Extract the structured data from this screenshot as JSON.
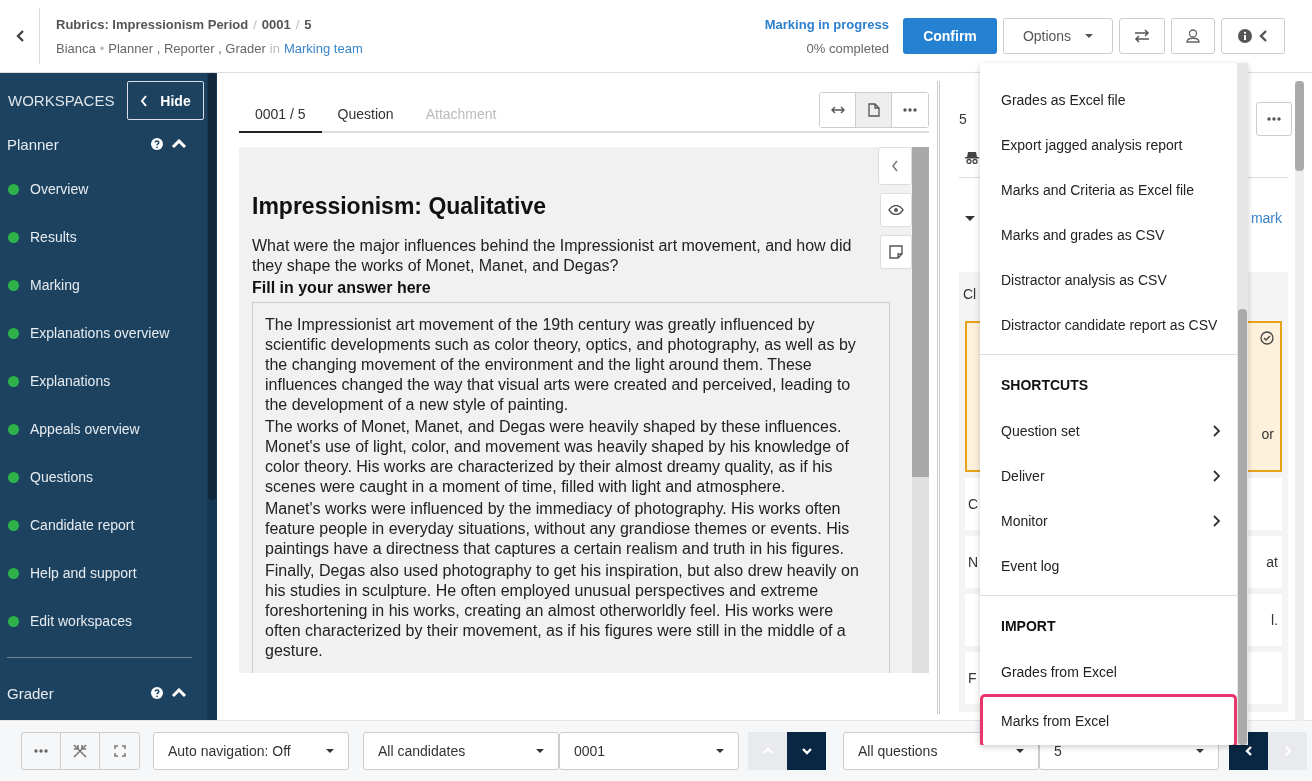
{
  "header": {
    "breadcrumb": [
      "Rubrics: Impressionism Period",
      "0001",
      "5"
    ],
    "separator": "/",
    "user": "Bianca",
    "bullet": "•",
    "roles": "Planner , Reporter , Grader",
    "in": "in",
    "team": "Marking team",
    "status": "Marking in progress",
    "progress": "0% completed",
    "confirm": "Confirm",
    "options": "Options"
  },
  "sidebar": {
    "title": "WORKSPACES",
    "hide": "Hide",
    "sections": [
      {
        "name": "Planner",
        "expanded": true,
        "items": [
          {
            "label": "Overview",
            "color": "#2db34a"
          },
          {
            "label": "Results",
            "color": "#2db34a"
          },
          {
            "label": "Marking",
            "color": "#2db34a"
          },
          {
            "label": "Explanations overview",
            "color": "#2db34a"
          },
          {
            "label": "Explanations",
            "color": "#2db34a"
          },
          {
            "label": "Appeals overview",
            "color": "#2db34a"
          },
          {
            "label": "Questions",
            "color": "#2db34a"
          },
          {
            "label": "Candidate report",
            "color": "#2db34a"
          },
          {
            "label": "Help and support",
            "color": "#2db34a"
          },
          {
            "label": "Edit workspaces",
            "color": "#2db34a"
          }
        ]
      },
      {
        "name": "Grader",
        "expanded": true
      }
    ]
  },
  "document": {
    "tabs": [
      {
        "label": "0001 / 5",
        "selected": true,
        "disabled": false
      },
      {
        "label": "Question",
        "selected": false,
        "disabled": false
      },
      {
        "label": "Attachment",
        "selected": false,
        "disabled": true
      }
    ],
    "title": "Impressionism: Qualitative",
    "question": "What were the major influences behind the Impressionist art movement, and how did they shape the works of Monet, Manet, and Degas?",
    "answer_label": "Fill in your answer here",
    "answer": [
      "The Impressionist art movement of the 19th century was greatly influenced by scientific developments such as color theory, optics, and photography, as well as by the changing movement of the environment and the light around them. These influences changed the way that visual arts were created and perceived, leading to the development of a new style of painting.",
      "The works of Monet, Manet, and Degas were heavily shaped by these influences. Monet's use of light, color, and movement was heavily shaped by his knowledge of color theory. His works are characterized by their almost dreamy quality, as if his scenes were caught in a moment of time, filled with light and atmosphere.",
      "Manet's works were influenced by the immediacy of photography. His works often feature people in everyday situations, without any grandiose themes or events. His paintings have a directness that captures a certain realism and truth in his figures.",
      "Finally, Degas also used photography to get his inspiration, but also drew heavily on his studies in sculpture. He often employed unusual perspectives and extreme foreshortening in his works, creating an almost otherworldly feel. His works were often characterized by their movement, as if his figures were still in the middle of a gesture."
    ]
  },
  "right_panel": {
    "counter": "5",
    "link": "mark",
    "card_heading": "Cl",
    "card_lines": [
      {
        "right": "or"
      }
    ],
    "rows": [
      {
        "left": "C"
      },
      {
        "left": "N",
        "right": "at"
      },
      {
        "right": "l."
      },
      {
        "left": "F"
      }
    ]
  },
  "menu": {
    "sections": [
      {
        "items": [
          {
            "label": "Grades as Excel file",
            "kind": "item",
            "highlighted": false
          },
          {
            "label": "Export jagged analysis report",
            "kind": "item",
            "highlighted": false
          },
          {
            "label": "Marks and Criteria as Excel file",
            "kind": "item",
            "highlighted": false
          },
          {
            "label": "Marks and grades as CSV",
            "kind": "item",
            "highlighted": false
          },
          {
            "label": "Distractor analysis as CSV",
            "kind": "item",
            "highlighted": false
          },
          {
            "label": "Distractor candidate report as CSV",
            "kind": "item",
            "highlighted": false
          }
        ]
      },
      {
        "heading": "SHORTCUTS",
        "items": [
          {
            "label": "Question set",
            "kind": "submenu",
            "highlighted": false
          },
          {
            "label": "Deliver",
            "kind": "submenu",
            "highlighted": false
          },
          {
            "label": "Monitor",
            "kind": "submenu",
            "highlighted": false
          },
          {
            "label": "Event log",
            "kind": "item",
            "highlighted": false
          }
        ]
      },
      {
        "heading": "IMPORT",
        "items": [
          {
            "label": "Grades from Excel",
            "kind": "item",
            "highlighted": false
          },
          {
            "label": "Marks from Excel",
            "kind": "item",
            "highlighted": true
          }
        ]
      }
    ]
  },
  "bottom_bar": {
    "auto_navigation": "Auto navigation: Off",
    "candidates": "All candidates",
    "candidate": "0001",
    "previous_disabled": true,
    "next_disabled": false,
    "questions": "All questions",
    "question": "5",
    "back_disabled": false,
    "forward_disabled": true
  }
}
